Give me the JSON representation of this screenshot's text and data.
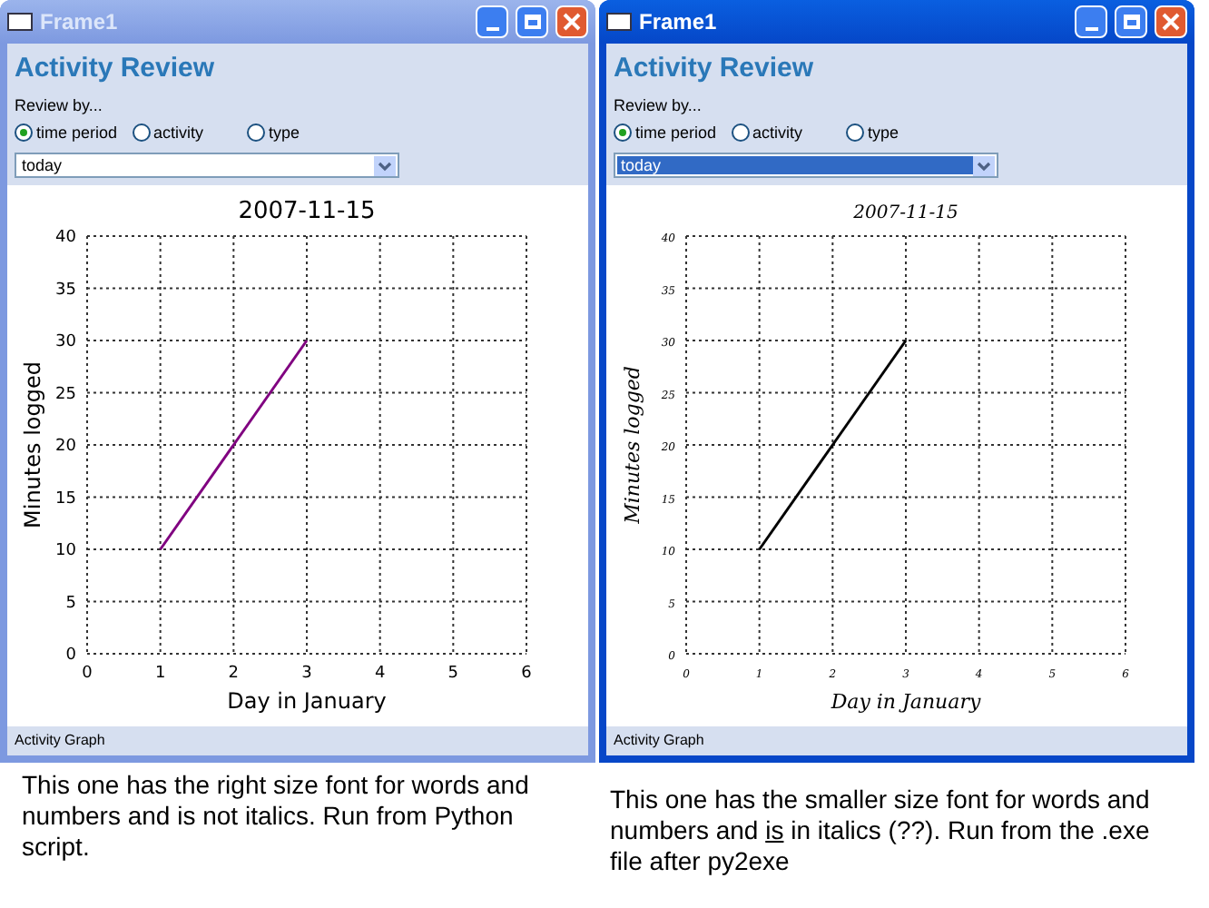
{
  "windows": [
    {
      "title": "Frame1",
      "active": false,
      "heading": "Activity Review",
      "review_label": "Review by...",
      "radios": [
        {
          "label": "time period",
          "selected": true
        },
        {
          "label": "activity",
          "selected": false
        },
        {
          "label": "type",
          "selected": false
        }
      ],
      "dropdown": {
        "value": "today",
        "highlighted": false
      },
      "italic_labels": false,
      "chart_data": {
        "type": "line",
        "grid": true,
        "title": "2007-11-15",
        "xlabel": "Day in January",
        "ylabel": "Minutes logged",
        "x": [
          1,
          2,
          3
        ],
        "series": [
          {
            "color": "#800080",
            "values": [
              10,
              20,
              30
            ]
          }
        ],
        "xlim": [
          0,
          6
        ],
        "ylim": [
          0,
          40
        ],
        "xticks": [
          0,
          1,
          2,
          3,
          4,
          5,
          6
        ],
        "yticks": [
          0,
          5,
          10,
          15,
          20,
          25,
          30,
          35,
          40
        ]
      },
      "status": "Activity Graph"
    },
    {
      "title": "Frame1",
      "active": true,
      "heading": "Activity Review",
      "review_label": "Review by...",
      "radios": [
        {
          "label": "time period",
          "selected": true
        },
        {
          "label": "activity",
          "selected": false
        },
        {
          "label": "type",
          "selected": false
        }
      ],
      "dropdown": {
        "value": "today",
        "highlighted": true
      },
      "italic_labels": true,
      "chart_data": {
        "type": "line",
        "grid": true,
        "title": "2007-11-15",
        "xlabel": "Day in January",
        "ylabel": "Minutes logged",
        "x": [
          1,
          2,
          3
        ],
        "series": [
          {
            "color": "#000000",
            "values": [
              10,
              20,
              30
            ]
          }
        ],
        "xlim": [
          0,
          6
        ],
        "ylim": [
          0,
          40
        ],
        "xticks": [
          0,
          1,
          2,
          3,
          4,
          5,
          6
        ],
        "yticks": [
          0,
          5,
          10,
          15,
          20,
          25,
          30,
          35,
          40
        ]
      },
      "status": "Activity Graph"
    }
  ],
  "captions": [
    [
      {
        "text": "This one has the right size font for words and numbers and is not italics.  Run from Python script.",
        "underline": false
      }
    ],
    [
      {
        "text": "This one has the smaller size font for words and numbers and ",
        "underline": false
      },
      {
        "text": "is",
        "underline": true
      },
      {
        "text": " in italics (??).  Run from the .exe file after py2exe",
        "underline": false
      }
    ]
  ]
}
